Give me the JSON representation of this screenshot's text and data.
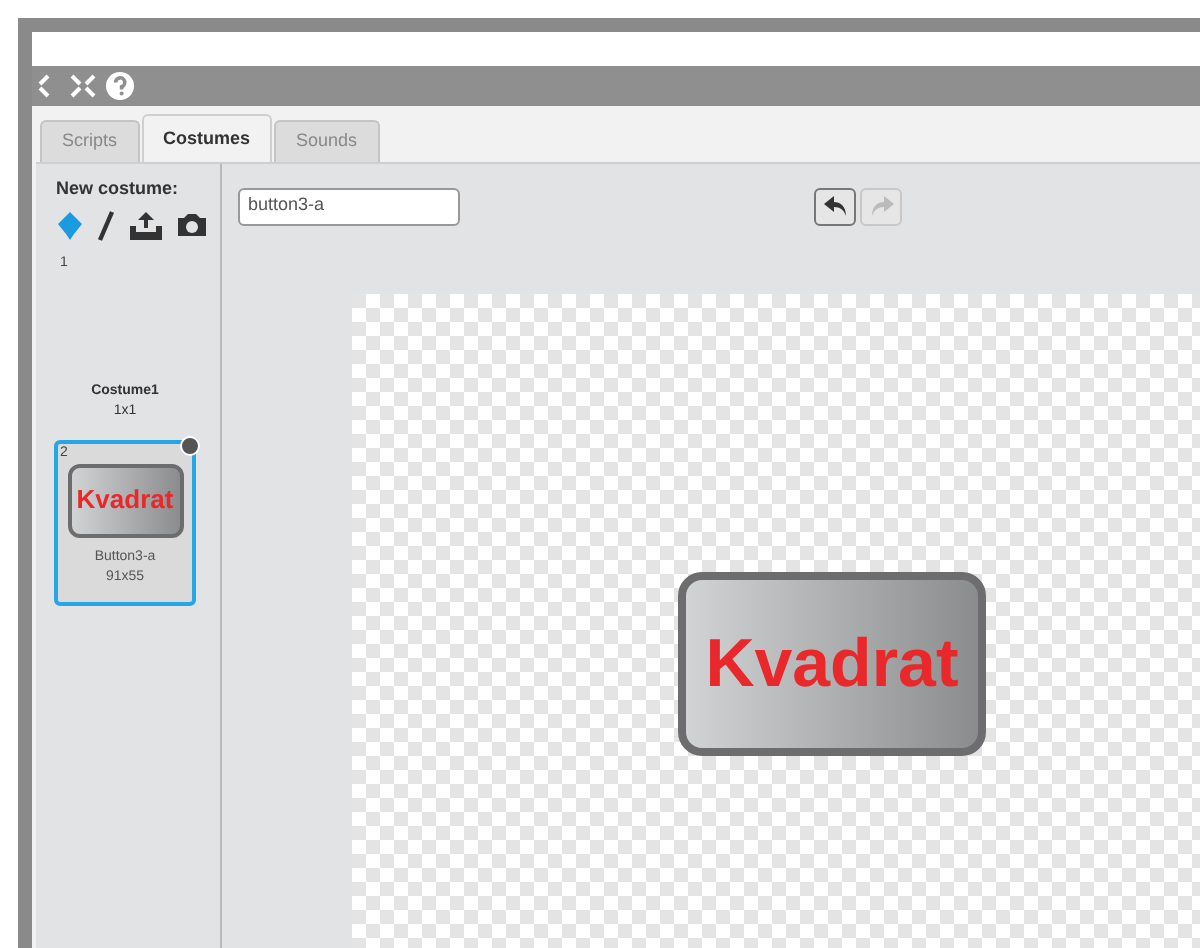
{
  "tabs": [
    {
      "label": "Scripts",
      "selected": false
    },
    {
      "label": "Costumes",
      "selected": true
    },
    {
      "label": "Sounds",
      "selected": false
    }
  ],
  "new_costume": {
    "label": "New costume:"
  },
  "costumes": [
    {
      "number": "1",
      "name": "Costume1",
      "size": "1x1",
      "selected": false
    },
    {
      "number": "2",
      "name": "Button3-a",
      "size": "91x55",
      "selected": true,
      "thumbnail_text": "Kvadrat"
    }
  ],
  "editor": {
    "name_field": "button3-a",
    "undo": {
      "disabled": false
    },
    "redo": {
      "disabled": true
    },
    "canvas_text": "Kvadrat"
  }
}
